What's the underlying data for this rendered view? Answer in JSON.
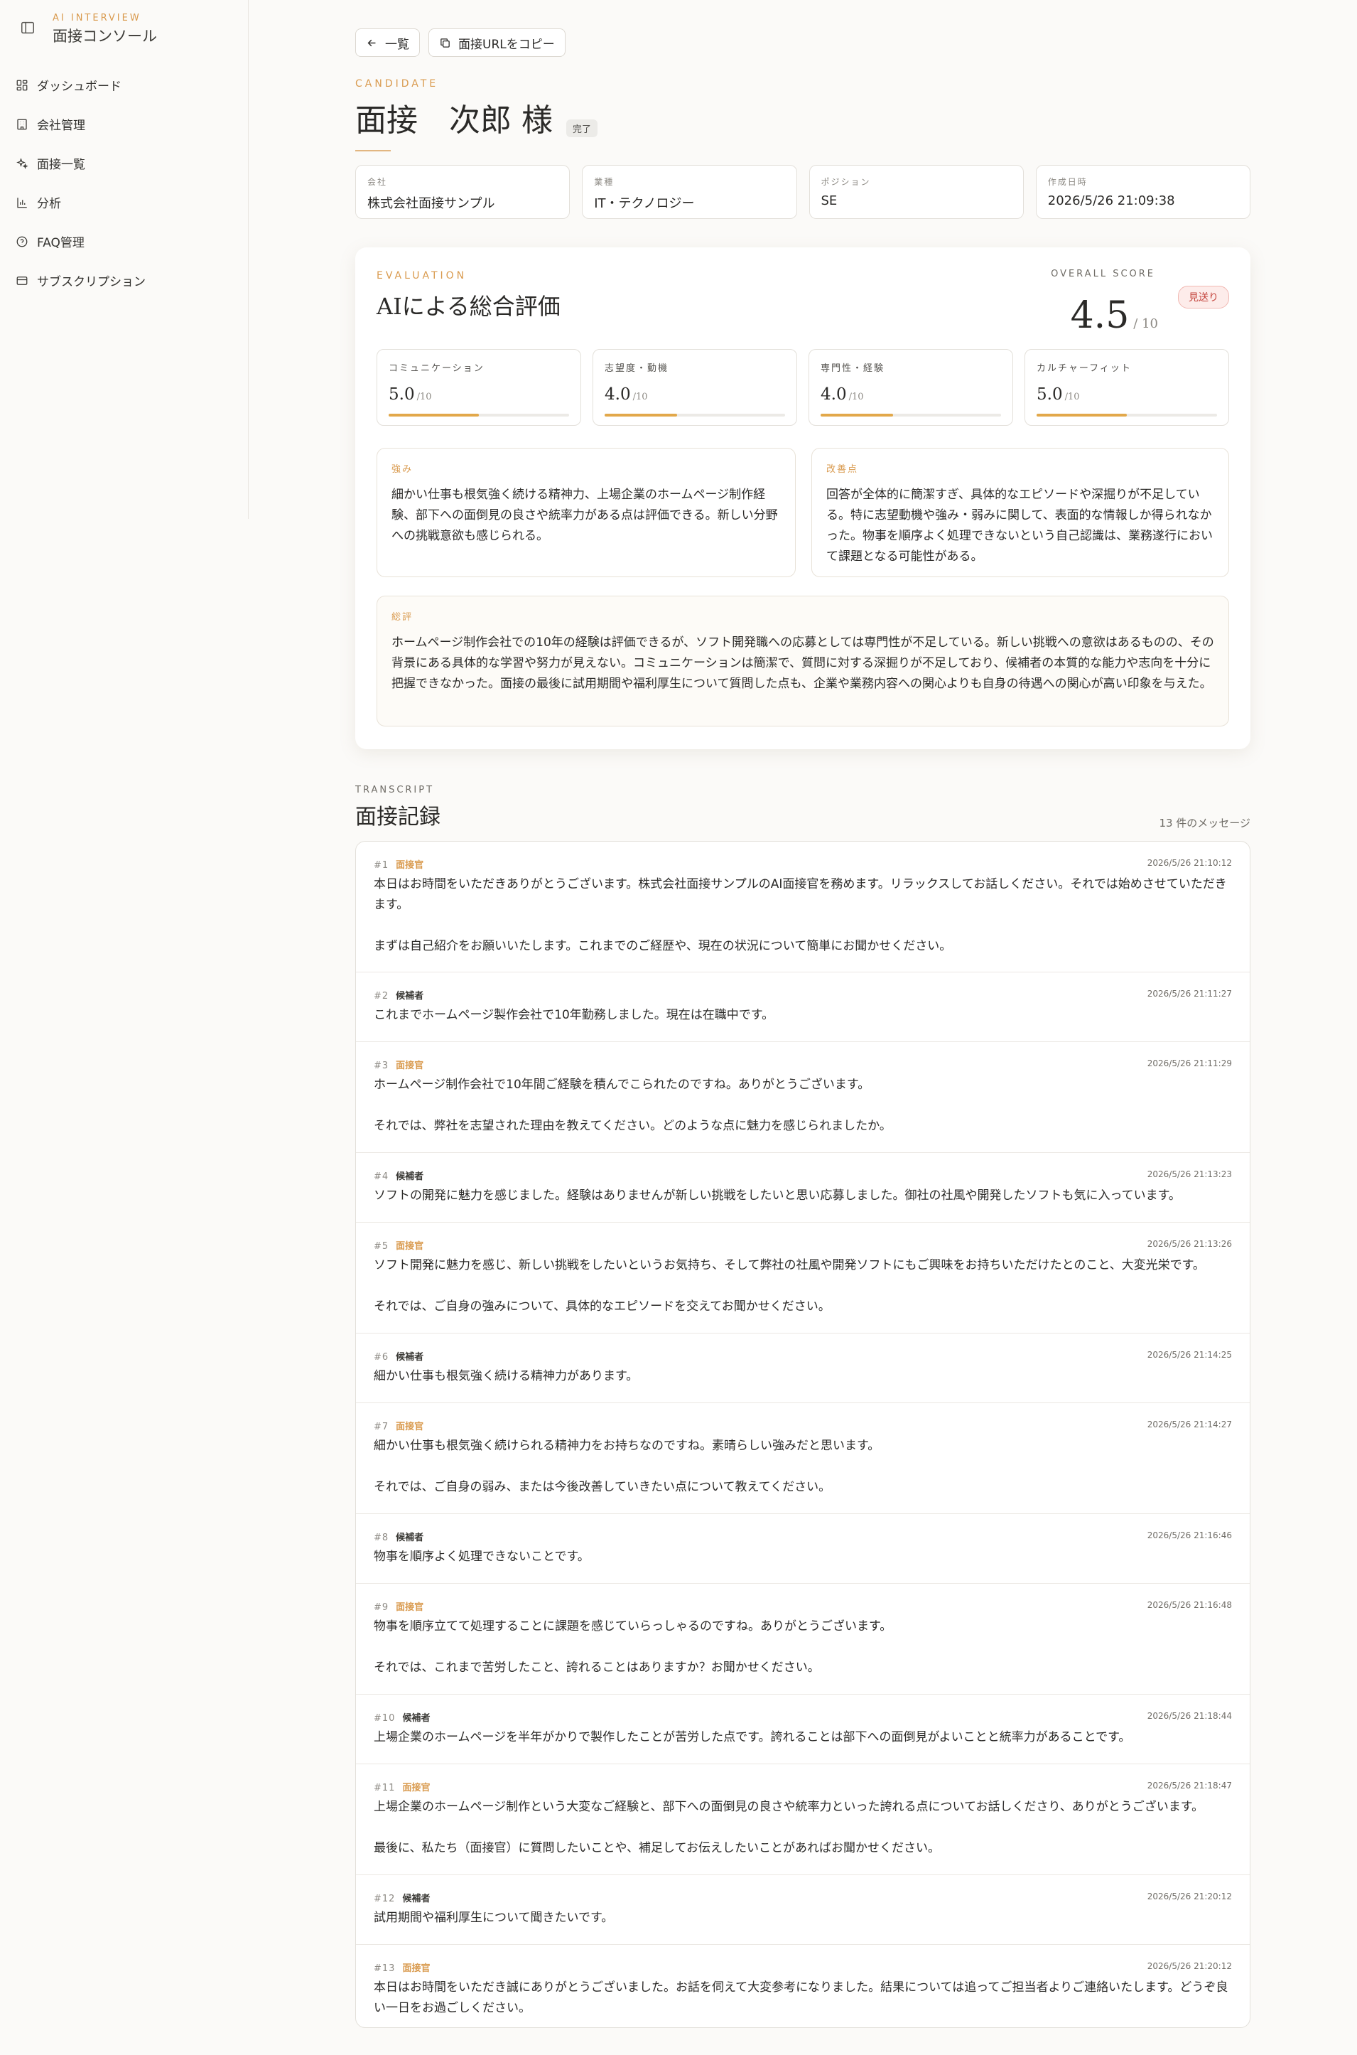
{
  "sidebar": {
    "kicker": "AI INTERVIEW",
    "title": "面接コンソール",
    "items": [
      {
        "label": "ダッシュボード",
        "icon": "dashboard-icon"
      },
      {
        "label": "会社管理",
        "icon": "building-icon"
      },
      {
        "label": "面接一覧",
        "icon": "sparkle-icon"
      },
      {
        "label": "分析",
        "icon": "bar-chart-icon"
      },
      {
        "label": "FAQ管理",
        "icon": "help-circle-icon"
      },
      {
        "label": "サブスクリプション",
        "icon": "credit-card-icon"
      }
    ]
  },
  "toolbar": {
    "back_label": "一覧",
    "copy_label": "面接URLをコピー"
  },
  "candidate": {
    "kicker": "CANDIDATE",
    "name": "面接　次郎 様",
    "status": "完了"
  },
  "meta": [
    {
      "label": "会社",
      "value": "株式会社面接サンプル"
    },
    {
      "label": "業種",
      "value": "IT・テクノロジー"
    },
    {
      "label": "ポジション",
      "value": "SE"
    },
    {
      "label": "作成日時",
      "value": "2026/5/26 21:09:38"
    }
  ],
  "evaluation": {
    "kicker": "EVALUATION",
    "title": "AIによる総合評価",
    "overall_label": "OVERALL SCORE",
    "overall_score": "4.5",
    "overall_max": "/ 10",
    "verdict": "見送り",
    "scores": [
      {
        "label": "コミュニケーション",
        "value": "5.0",
        "max": "/10",
        "fraction": 0.5
      },
      {
        "label": "志望度・動機",
        "value": "4.0",
        "max": "/10",
        "fraction": 0.4
      },
      {
        "label": "専門性・経験",
        "value": "4.0",
        "max": "/10",
        "fraction": 0.4
      },
      {
        "label": "カルチャーフィット",
        "value": "5.0",
        "max": "/10",
        "fraction": 0.5
      }
    ],
    "strengths_label": "強み",
    "strengths": "細かい仕事も根気強く続ける精神力、上場企業のホームページ制作経験、部下への面倒見の良さや統率力がある点は評価できる。新しい分野への挑戦意欲も感じられる。",
    "improvements_label": "改善点",
    "improvements": "回答が全体的に簡潔すぎ、具体的なエピソードや深掘りが不足している。特に志望動機や強み・弱みに関して、表面的な情報しか得られなかった。物事を順序よく処理できないという自己認識は、業務遂行において課題となる可能性がある。",
    "summary_label": "総評",
    "summary": "ホームページ制作会社での10年の経験は評価できるが、ソフト開発職への応募としては専門性が不足している。新しい挑戦への意欲はあるものの、その背景にある具体的な学習や努力が見えない。コミュニケーションは簡潔で、質問に対する深掘りが不足しており、候補者の本質的な能力や志向を十分に把握できなかった。面接の最後に試用期間や福利厚生について質問した点も、企業や業務内容への関心よりも自身の待遇への関心が高い印象を与えた。"
  },
  "transcript": {
    "kicker": "TRANSCRIPT",
    "title": "面接記録",
    "count": "13 件のメッセージ",
    "messages": [
      {
        "idx": "#1",
        "role": "面接官",
        "time": "2026/5/26 21:10:12",
        "text": "本日はお時間をいただきありがとうございます。株式会社面接サンプルのAI面接官を務めます。リラックスしてお話しください。それでは始めさせていただきます。\n\nまずは自己紹介をお願いいたします。これまでのご経歴や、現在の状況について簡単にお聞かせください。"
      },
      {
        "idx": "#2",
        "role": "候補者",
        "time": "2026/5/26 21:11:27",
        "text": "これまでホームページ製作会社で10年勤務しました。現在は在職中です。"
      },
      {
        "idx": "#3",
        "role": "面接官",
        "time": "2026/5/26 21:11:29",
        "text": "ホームページ制作会社で10年間ご経験を積んでこられたのですね。ありがとうございます。\n\nそれでは、弊社を志望された理由を教えてください。どのような点に魅力を感じられましたか。"
      },
      {
        "idx": "#4",
        "role": "候補者",
        "time": "2026/5/26 21:13:23",
        "text": "ソフトの開発に魅力を感じました。経験はありませんが新しい挑戦をしたいと思い応募しました。御社の社風や開発したソフトも気に入っています。"
      },
      {
        "idx": "#5",
        "role": "面接官",
        "time": "2026/5/26 21:13:26",
        "text": "ソフト開発に魅力を感じ、新しい挑戦をしたいというお気持ち、そして弊社の社風や開発ソフトにもご興味をお持ちいただけたとのこと、大変光栄です。\n\nそれでは、ご自身の強みについて、具体的なエピソードを交えてお聞かせください。"
      },
      {
        "idx": "#6",
        "role": "候補者",
        "time": "2026/5/26 21:14:25",
        "text": "細かい仕事も根気強く続ける精神力があります。"
      },
      {
        "idx": "#7",
        "role": "面接官",
        "time": "2026/5/26 21:14:27",
        "text": "細かい仕事も根気強く続けられる精神力をお持ちなのですね。素晴らしい強みだと思います。\n\nそれでは、ご自身の弱み、または今後改善していきたい点について教えてください。"
      },
      {
        "idx": "#8",
        "role": "候補者",
        "time": "2026/5/26 21:16:46",
        "text": "物事を順序よく処理できないことです。"
      },
      {
        "idx": "#9",
        "role": "面接官",
        "time": "2026/5/26 21:16:48",
        "text": "物事を順序立てて処理することに課題を感じていらっしゃるのですね。ありがとうございます。\n\nそれでは、これまで苦労したこと、誇れることはありますか？お聞かせください。"
      },
      {
        "idx": "#10",
        "role": "候補者",
        "time": "2026/5/26 21:18:44",
        "text": "上場企業のホームページを半年がかりで製作したことが苦労した点です。誇れることは部下への面倒見がよいことと統率力があることです。"
      },
      {
        "idx": "#11",
        "role": "面接官",
        "time": "2026/5/26 21:18:47",
        "text": "上場企業のホームページ制作という大変なご経験と、部下への面倒見の良さや統率力といった誇れる点についてお話しくださり、ありがとうございます。\n\n最後に、私たち（面接官）に質問したいことや、補足してお伝えしたいことがあればお聞かせください。"
      },
      {
        "idx": "#12",
        "role": "候補者",
        "time": "2026/5/26 21:20:12",
        "text": "試用期間や福利厚生について聞きたいです。"
      },
      {
        "idx": "#13",
        "role": "面接官",
        "time": "2026/5/26 21:20:12",
        "text": "本日はお時間をいただき誠にありがとうございました。お話を伺えて大変参考になりました。結果については追ってご担当者よりご連絡いたします。どうぞ良い一日をお過ごしください。"
      }
    ]
  },
  "colors": {
    "accent": "#d99a4e",
    "bar_fill": "#e2a84a",
    "verdict_text": "#c4443c"
  }
}
